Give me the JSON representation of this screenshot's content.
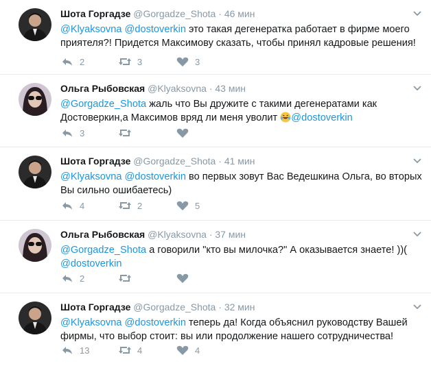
{
  "tweets": [
    {
      "name": "Шота Горгадзе",
      "handle": "@Gorgadze_Shota",
      "time": "46 мин",
      "line1": [
        {
          "t": "@Klyaksovna",
          "m": true
        },
        {
          "t": " ",
          "m": false
        },
        {
          "t": "@dostoverkin",
          "m": true
        },
        {
          "t": " это такая дегенератка работает в фирме моего",
          "m": false
        }
      ],
      "line2": [
        {
          "t": "приятеля?! Придется Максимову сказать, чтобы принял кадровые решения!",
          "m": false
        }
      ],
      "replies": "2",
      "retweets": "3",
      "likes": "3"
    },
    {
      "name": "Ольга Рыбовская",
      "handle": "@Klyaksovna",
      "time": "43 мин",
      "line1": [
        {
          "t": "@Gorgadze_Shota",
          "m": true
        },
        {
          "t": " жаль что Вы дружите с такими дегенератами как",
          "m": false
        }
      ],
      "line2": [
        {
          "t": "Достоверкин,а Максимов вряд ли меня уволит ",
          "m": false
        },
        {
          "t": "@dostoverkin",
          "m": true
        }
      ],
      "replies": "3",
      "retweets": "",
      "likes": ""
    },
    {
      "name": "Шота Горгадзе",
      "handle": "@Gorgadze_Shota",
      "time": "41 мин",
      "line1": [
        {
          "t": "@Klyaksovna",
          "m": true
        },
        {
          "t": " ",
          "m": false
        },
        {
          "t": "@dostoverkin",
          "m": true
        },
        {
          "t": " во первых зовут Вас Ведешкина Ольга, во вторых",
          "m": false
        }
      ],
      "line2": [
        {
          "t": "Вы сильно ошибаетесь)",
          "m": false
        }
      ],
      "replies": "4",
      "retweets": "2",
      "likes": "5"
    },
    {
      "name": "Ольга Рыбовская",
      "handle": "@Klyaksovna",
      "time": "37 мин",
      "line1": [
        {
          "t": "@Gorgadze_Shota",
          "m": true
        },
        {
          "t": " а говорили \"кто вы милочка?\" А оказывается знаете! ))(",
          "m": false
        }
      ],
      "line2": [
        {
          "t": "@dostoverkin",
          "m": true
        }
      ],
      "replies": "2",
      "retweets": "",
      "likes": ""
    },
    {
      "name": "Шота Горгадзе",
      "handle": "@Gorgadze_Shota",
      "time": "32 мин",
      "line1": [
        {
          "t": "@Klyaksovna",
          "m": true
        },
        {
          "t": " ",
          "m": false
        },
        {
          "t": "@dostoverkin",
          "m": true
        },
        {
          "t": " теперь да! Когда объяснил руководству Вашей",
          "m": false
        }
      ],
      "line2": [
        {
          "t": "фирмы, что выбор стоит: вы или продолжение нашего сотрудничества!",
          "m": false
        }
      ],
      "replies": "13",
      "retweets": "4",
      "likes": "4"
    }
  ],
  "separator": "·",
  "icons": {
    "reply": "reply-icon",
    "retweet": "retweet-icon",
    "like": "heart-icon",
    "caret": "chevron-down-icon",
    "emoji": "laughing-tears-emoji-icon"
  },
  "colors": {
    "mention": "#1b95e0",
    "muted": "#8899a6",
    "divider": "#e6ecf0"
  }
}
